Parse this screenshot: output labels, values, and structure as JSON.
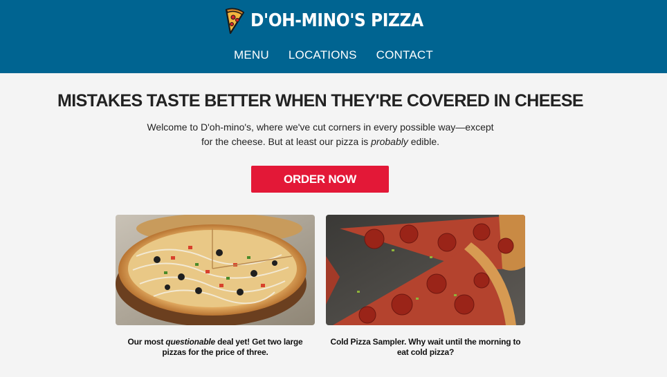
{
  "brand": {
    "name": "D'OH-MINO'S PIZZA",
    "logo_icon": "pizza-slice-icon"
  },
  "nav": {
    "items": [
      "MENU",
      "LOCATIONS",
      "CONTACT"
    ]
  },
  "hero": {
    "headline": "MISTAKES TASTE BETTER WHEN THEY'RE COVERED IN CHEESE",
    "intro_part1": "Welcome to D'oh-mino's, where we've cut corners in every possible way—except for the cheese. But at least our pizza is ",
    "intro_emphasis": "probably",
    "intro_part2": " edible.",
    "cta_label": "ORDER NOW"
  },
  "cards": [
    {
      "caption_part1": "Our most ",
      "caption_emphasis": "questionable",
      "caption_part2": " deal yet! Get two large pizzas for the price of three.",
      "image": "supreme-pizza-photo"
    },
    {
      "caption": "Cold Pizza Sampler. Why wait until the morning to eat cold pizza?",
      "image": "pepperoni-slices-photo"
    }
  ],
  "colors": {
    "header": "#006491",
    "cta": "#e31837",
    "background": "#f4f4f4"
  }
}
